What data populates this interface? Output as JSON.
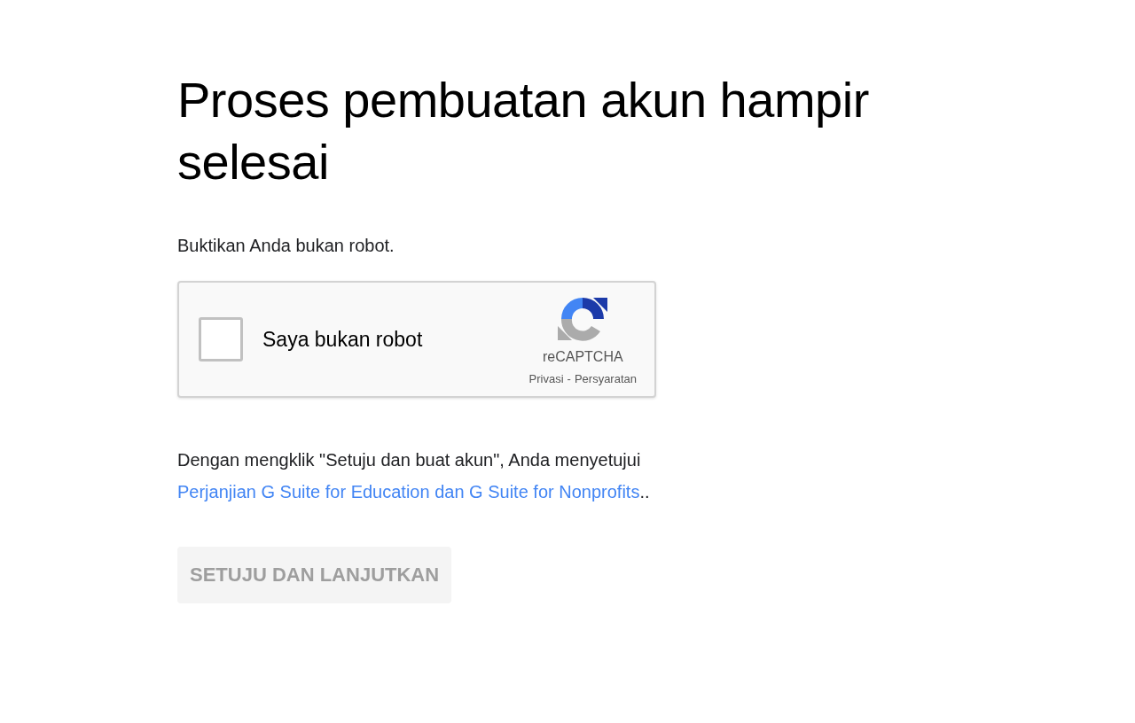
{
  "title": "Proses pembuatan akun hampir selesai",
  "prompt": "Buktikan Anda bukan robot.",
  "captcha": {
    "label": "Saya bukan robot",
    "checked": false,
    "brand": "reCAPTCHA",
    "privacy": "Privasi",
    "separator": "-",
    "terms": "Persyaratan"
  },
  "agreement": {
    "text": "Dengan mengklik \"Setuju dan buat akun\", Anda menyetujui",
    "link": "Perjanjian G Suite for Education dan G Suite for Nonprofits",
    "after": ".."
  },
  "button": {
    "label": "SETUJU DAN LANJUTKAN",
    "disabled": true
  }
}
